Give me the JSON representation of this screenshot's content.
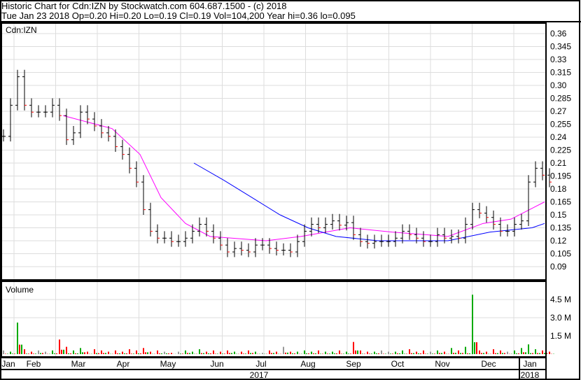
{
  "header": {
    "title": "Historic Chart for Cdn:IZN by Stockwatch.com 604.687.1500 - (c) 2018",
    "quote": "Tue Jan 23 2018  Op=0.20  Hi=0.20  Lo=0.19  Cl=0.19  Vol=104,200  Year hi=0.36  lo=0.095"
  },
  "chart_data": {
    "type": "line",
    "symbol_label": "Cdn:IZN",
    "volume_label": "Volume",
    "price_ticks": [
      "0.36",
      "0.345",
      "0.33",
      "0.315",
      "0.30",
      "0.285",
      "0.27",
      "0.255",
      "0.24",
      "0.225",
      "0.21",
      "0.195",
      "0.18",
      "0.165",
      "0.15",
      "0.135",
      "0.12",
      "0.105",
      "0.09"
    ],
    "ylim": [
      0.078,
      0.375
    ],
    "volume_ticks": [
      "4.5 M",
      "3.0 M",
      "1.5 M"
    ],
    "volume_tick_values": [
      4.5,
      3.0,
      1.5
    ],
    "months": [
      "Jan",
      "Feb",
      "Mar",
      "Apr",
      "May",
      "Jun",
      "Jul",
      "Aug",
      "Sep",
      "Oct",
      "Nov",
      "Dec",
      "Jan"
    ],
    "years": [
      "2017",
      "2018"
    ],
    "close": [
      0.241,
      0.277,
      0.31,
      0.277,
      0.269,
      0.269,
      0.269,
      0.277,
      0.265,
      0.237,
      0.245,
      0.269,
      0.261,
      0.253,
      0.245,
      0.241,
      0.229,
      0.22,
      0.204,
      0.188,
      0.156,
      0.131,
      0.123,
      0.123,
      0.119,
      0.119,
      0.123,
      0.131,
      0.139,
      0.131,
      0.123,
      0.115,
      0.107,
      0.111,
      0.109,
      0.107,
      0.115,
      0.115,
      0.111,
      0.109,
      0.109,
      0.107,
      0.119,
      0.131,
      0.139,
      0.135,
      0.139,
      0.143,
      0.138,
      0.141,
      0.127,
      0.119,
      0.117,
      0.119,
      0.119,
      0.119,
      0.123,
      0.131,
      0.127,
      0.123,
      0.119,
      0.119,
      0.127,
      0.123,
      0.125,
      0.123,
      0.139,
      0.156,
      0.152,
      0.147,
      0.139,
      0.131,
      0.131,
      0.139,
      0.143,
      0.188,
      0.204,
      0.196,
      0.188
    ],
    "ma_magenta": [
      [
        8.5,
        0.265
      ],
      [
        15.5,
        0.25
      ],
      [
        19.5,
        0.22
      ],
      [
        22.5,
        0.17
      ],
      [
        26,
        0.14
      ],
      [
        29.5,
        0.125
      ],
      [
        37.5,
        0.12
      ],
      [
        42.5,
        0.125
      ],
      [
        49.5,
        0.135
      ],
      [
        55.5,
        0.13
      ],
      [
        63.5,
        0.125
      ],
      [
        68.5,
        0.14
      ],
      [
        72.5,
        0.145
      ],
      [
        77.3,
        0.165
      ]
    ],
    "ma_blue": [
      [
        27.2,
        0.21
      ],
      [
        31.5,
        0.19
      ],
      [
        35.5,
        0.17
      ],
      [
        39.5,
        0.15
      ],
      [
        43.5,
        0.135
      ],
      [
        47.5,
        0.125
      ],
      [
        53.5,
        0.12
      ],
      [
        63.5,
        0.12
      ],
      [
        69.5,
        0.13
      ],
      [
        75.5,
        0.135
      ],
      [
        77.3,
        0.14
      ]
    ],
    "volume_millions": [
      0.3,
      0.2,
      2.6,
      0.4,
      0.2,
      0.3,
      0.2,
      0.3,
      1.2,
      0.6,
      0.3,
      0.5,
      0.2,
      0.4,
      0.3,
      0.2,
      0.3,
      0.2,
      0.4,
      0.3,
      0.5,
      0.2,
      0.3,
      0.2,
      0.1,
      0.2,
      0.3,
      0.2,
      0.4,
      0.2,
      0.3,
      0.2,
      0.3,
      0.2,
      0.2,
      0.3,
      0.2,
      0.1,
      0.3,
      0.2,
      0.6,
      0.2,
      0.2,
      0.3,
      0.2,
      0.3,
      0.2,
      0.2,
      0.3,
      0.2,
      1.0,
      0.3,
      0.2,
      0.2,
      0.3,
      0.2,
      0.2,
      0.3,
      0.4,
      0.2,
      0.3,
      0.2,
      0.3,
      0.2,
      0.5,
      0.3,
      0.6,
      4.9,
      0.3,
      0.2,
      0.4,
      0.3,
      0.2,
      0.3,
      0.5,
      0.8,
      0.4,
      0.3,
      0.2
    ],
    "colors": {
      "up": "#00aa00",
      "down": "#ff0000",
      "flat": "#999999",
      "ma_fast": "#ff00ff",
      "ma_slow": "#0000ff",
      "price_bar": "#000000"
    }
  }
}
